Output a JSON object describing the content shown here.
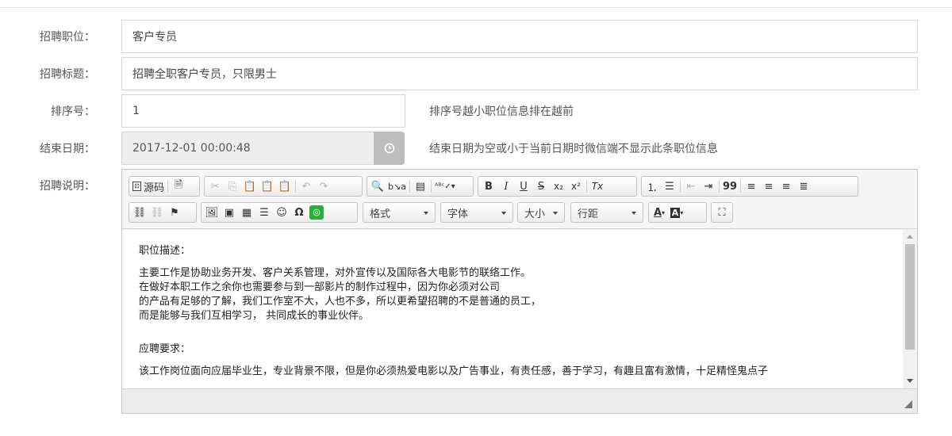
{
  "form": {
    "position_label": "招聘职位：",
    "position_value": "客户专员",
    "title_label": "招聘标题：",
    "title_value": "招聘全职客户专员，只限男士",
    "sort_label": "排序号：",
    "sort_value": "1",
    "sort_hint": "排序号越小职位信息排在越前",
    "end_label": "结束日期：",
    "end_value": "2017-12-01 00:00:48",
    "end_hint": "结束日期为空或小于当前日期时微信端不显示此条职位信息",
    "desc_label": "招聘说明："
  },
  "toolbar": {
    "source_label": "源码",
    "format_combo": "格式",
    "font_combo": "字体",
    "size_combo": "大小",
    "lineheight_combo": "行距",
    "bold": "B",
    "italic": "I",
    "underline": "U",
    "strike": "S",
    "subscript": "x₂",
    "superscript": "x²",
    "removeformat": "Tx",
    "blockquote": "99",
    "omega": "Ω",
    "smiley": "☺",
    "textcolor": "A",
    "bgcolor": "A"
  },
  "content": {
    "heading1": "职位描述：",
    "lines1": [
      "主要工作是协助业务开发、客户关系管理，对外宣传以及国际各大电影节的联络工作。",
      "在做好本职工作之余你也需要参与到一部影片的制作过程中，因为你必须对公司",
      "的产品有足够的了解，我们工作室不大，人也不多，所以更希望招聘的不是普通的员工，",
      "而是能够与我们互相学习， 共同成长的事业伙伴。"
    ],
    "heading2": "应聘要求：",
    "line2": "该工作岗位面向应届毕业生，专业背景不限，但是你必须热爱电影以及广告事业，有责任感，善于学习，有趣且富有激情，十足精怪鬼点子"
  },
  "colors": {
    "border": "#d6d6d6",
    "readonly_bg": "#eeeeee",
    "clock_btn": "#bdbdbd",
    "wechat_green": "#2aae3c"
  }
}
